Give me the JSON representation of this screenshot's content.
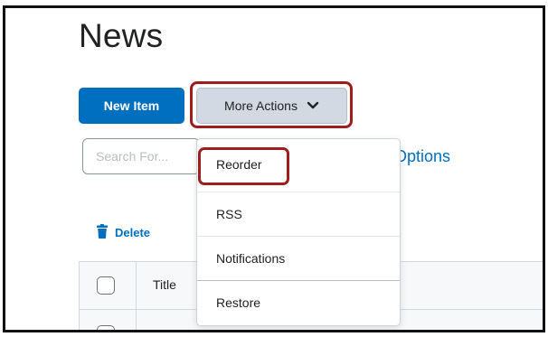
{
  "page": {
    "title": "News"
  },
  "toolbar": {
    "new_item_label": "New Item",
    "more_actions_label": "More Actions"
  },
  "search": {
    "placeholder": "Search For..."
  },
  "options": {
    "label": "Options"
  },
  "actions": {
    "delete_label": "Delete"
  },
  "table": {
    "columns": [
      "Title"
    ]
  },
  "menu": {
    "items": [
      {
        "label": "Reorder"
      },
      {
        "label": "RSS"
      },
      {
        "label": "Notifications"
      },
      {
        "label": "Restore"
      }
    ]
  },
  "colors": {
    "primary": "#006fbf",
    "highlight": "#a01d1d",
    "secondary_button": "#d3d9e3"
  },
  "icons": {
    "chevron": "chevron-down-icon",
    "delete": "trash-icon"
  }
}
